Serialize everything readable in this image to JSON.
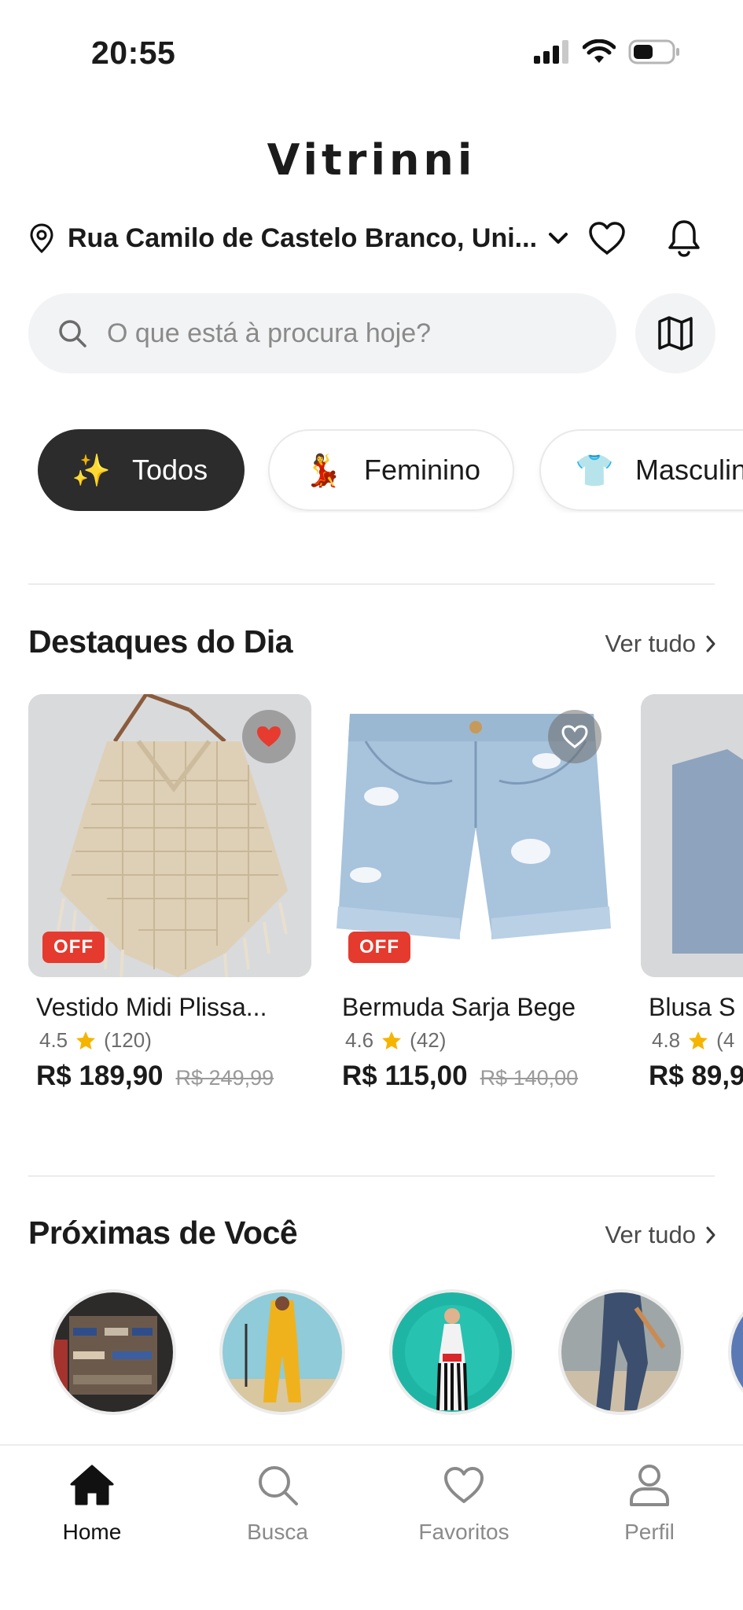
{
  "status_bar": {
    "time": "20:55",
    "icons": [
      "cellular-signal-icon",
      "wifi-icon",
      "battery-icon"
    ]
  },
  "header": {
    "app_title": "Vitrinni",
    "location": "Rua Camilo de Castelo Branco, Uni...",
    "icons": [
      "map-pin-icon",
      "chevron-down-icon",
      "heart-icon",
      "bell-icon"
    ]
  },
  "search": {
    "placeholder": "O que está à procura hoje?",
    "map_icon": "map-icon"
  },
  "categories": [
    {
      "emoji": "✨",
      "label": "Todos",
      "active": true
    },
    {
      "emoji": "💃",
      "label": "Feminino",
      "active": false
    },
    {
      "emoji": "👕",
      "label": "Masculino",
      "active": false
    }
  ],
  "highlights": {
    "title": "Destaques do Dia",
    "see_all": "Ver tudo",
    "products": [
      {
        "name": "Vestido Midi Plissa...",
        "rating": "4.5",
        "reviews": "(120)",
        "price": "R$ 189,90",
        "old_price": "R$ 249,99",
        "badge": "OFF",
        "favorited": true
      },
      {
        "name": "Bermuda Sarja Bege",
        "rating": "4.6",
        "reviews": "(42)",
        "price": "R$ 115,00",
        "old_price": "R$ 140,00",
        "badge": "OFF",
        "favorited": false
      },
      {
        "name": "Blusa S",
        "rating": "4.8",
        "reviews": "(4",
        "price": "R$ 89,9",
        "old_price": "",
        "badge": "",
        "favorited": false
      }
    ]
  },
  "nearby": {
    "title": "Próximas de Você",
    "see_all": "Ver tudo"
  },
  "bottom_nav": [
    {
      "label": "Home",
      "icon": "home-icon",
      "active": true
    },
    {
      "label": "Busca",
      "icon": "search-icon",
      "active": false
    },
    {
      "label": "Favoritos",
      "icon": "heart-icon",
      "active": false
    },
    {
      "label": "Perfil",
      "icon": "user-icon",
      "active": false
    }
  ],
  "colors": {
    "accent_dark": "#2c2c2c",
    "off_badge": "#e53a2e",
    "favorite_red": "#e63b2e",
    "star": "#f5b400"
  }
}
